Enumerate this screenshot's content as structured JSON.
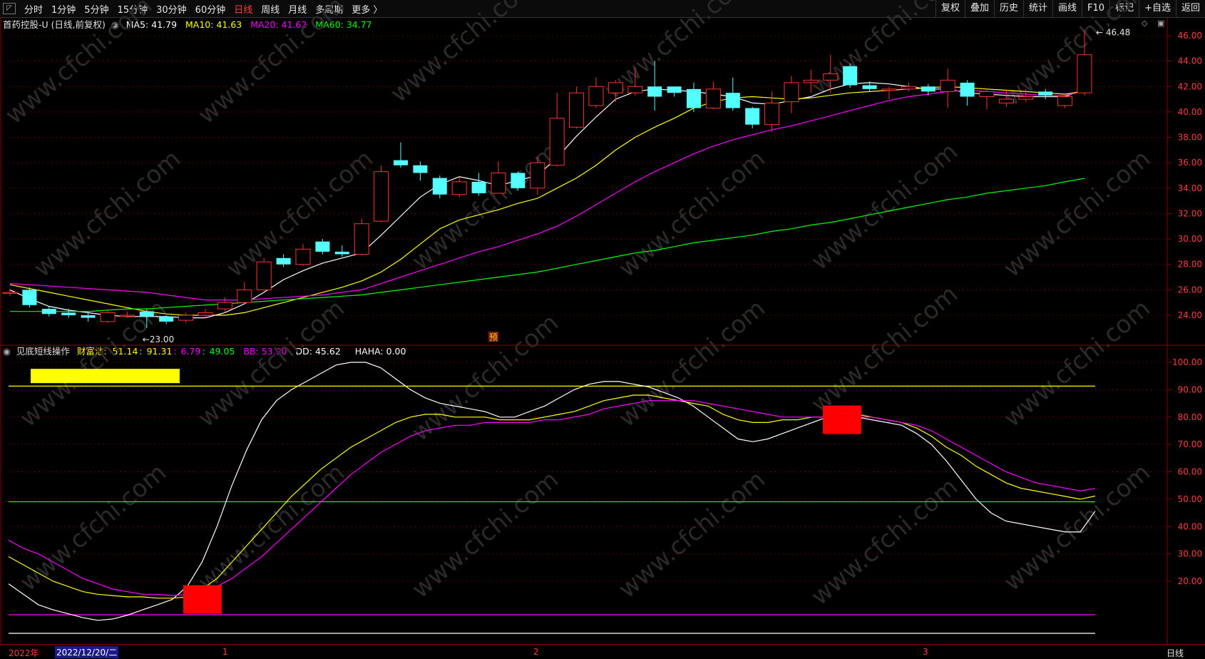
{
  "toolbar": {
    "timeframes": [
      "分时",
      "1分钟",
      "5分钟",
      "15分钟",
      "30分钟",
      "60分钟",
      "日线",
      "周线",
      "月线",
      "多周期",
      "更多 〉"
    ],
    "active_timeframe": "日线",
    "tools": [
      "复权",
      "叠加",
      "历史",
      "统计",
      "画线",
      "F10",
      "标记",
      "+自选",
      "返回"
    ]
  },
  "main_legend": {
    "title": "首药控股-U (日线,前复权)",
    "ma5": "MA5: 41.79",
    "ma10": "MA10: 41.63",
    "ma20": "MA20: 41.62",
    "ma60": "MA60: 34.77",
    "colors": {
      "ma5": "#ffffff",
      "ma10": "#ffff00",
      "ma20": "#ff00ff",
      "ma60": "#00ff00"
    }
  },
  "ind_legend": {
    "title": "见底短线操作",
    "label": "财富池:",
    "v1": "51.14",
    "v2": "91.31",
    "v3": "6.79",
    "v4": "49.05",
    "bb": "BB: 53.90",
    "dd": "DD: 45.62",
    "haha": "HAHA: 0.00"
  },
  "price_annotations": {
    "high": "46.48",
    "low": "23.00",
    "marker": "预"
  },
  "bottom": {
    "year": "2022年",
    "date_box": "2022/12/20/二",
    "months": [
      "1",
      "2",
      "3"
    ],
    "period": "日线"
  },
  "watermark": "www.cfchi.com",
  "chart_data": [
    {
      "type": "candlestick",
      "ylim": [
        22.0,
        47.0
      ],
      "y_ticks": [
        "46.00",
        "44.00",
        "42.00",
        "40.00",
        "38.00",
        "36.00",
        "34.00",
        "32.00",
        "30.00",
        "28.00",
        "26.00",
        "24.00"
      ],
      "candles": [
        [
          25.8,
          25.8,
          26.1,
          25.5
        ],
        [
          26.0,
          24.8,
          26.2,
          24.6
        ],
        [
          24.5,
          24.1,
          24.7,
          23.9
        ],
        [
          24.2,
          24.0,
          24.5,
          23.8
        ],
        [
          24.0,
          23.8,
          24.3,
          23.5
        ],
        [
          23.5,
          24.2,
          24.4,
          23.4
        ],
        [
          24.0,
          24.0,
          24.3,
          23.8
        ],
        [
          24.3,
          23.9,
          24.5,
          23.0
        ],
        [
          23.9,
          23.5,
          24.0,
          23.3
        ],
        [
          23.6,
          24.0,
          24.2,
          23.4
        ],
        [
          24.0,
          24.2,
          24.5,
          23.8
        ],
        [
          24.5,
          25.0,
          25.4,
          24.2
        ],
        [
          25.0,
          26.0,
          26.6,
          24.9
        ],
        [
          26.0,
          28.2,
          28.5,
          25.9
        ],
        [
          28.5,
          28.0,
          28.8,
          27.8
        ],
        [
          28.0,
          29.2,
          29.6,
          27.9
        ],
        [
          29.8,
          29.0,
          30.0,
          28.8
        ],
        [
          29.0,
          28.8,
          29.5,
          28.6
        ],
        [
          28.8,
          31.2,
          31.6,
          28.7
        ],
        [
          31.4,
          35.3,
          35.8,
          31.3
        ],
        [
          36.2,
          35.8,
          37.6,
          35.6
        ],
        [
          35.8,
          35.2,
          36.1,
          34.6
        ],
        [
          34.8,
          33.5,
          35.0,
          33.2
        ],
        [
          33.5,
          34.5,
          34.9,
          33.3
        ],
        [
          34.5,
          33.6,
          35.2,
          33.4
        ],
        [
          33.6,
          35.2,
          36.1,
          33.6
        ],
        [
          35.2,
          34.0,
          35.3,
          33.8
        ],
        [
          34.0,
          36.0,
          36.5,
          33.5
        ],
        [
          35.8,
          39.5,
          41.5,
          35.7
        ],
        [
          38.8,
          41.5,
          42.0,
          38.7
        ],
        [
          40.5,
          42.0,
          42.7,
          40.3
        ],
        [
          41.5,
          42.3,
          42.5,
          40.8
        ],
        [
          41.5,
          42.0,
          43.5,
          41.3
        ],
        [
          42.0,
          41.2,
          44.0,
          40.1
        ],
        [
          42.0,
          41.5,
          41.8,
          41.2
        ],
        [
          41.8,
          40.3,
          42.3,
          40.0
        ],
        [
          40.3,
          41.8,
          42.4,
          40.2
        ],
        [
          41.5,
          40.3,
          42.7,
          40.1
        ],
        [
          40.3,
          39.0,
          40.4,
          38.7
        ],
        [
          39.0,
          40.7,
          41.6,
          38.4
        ],
        [
          40.8,
          42.3,
          42.8,
          39.9
        ],
        [
          42.3,
          42.5,
          43.3,
          41.5
        ],
        [
          42.5,
          43.0,
          44.5,
          41.5
        ],
        [
          43.6,
          42.1,
          43.8,
          41.9
        ],
        [
          42.1,
          41.8,
          42.4,
          41.6
        ],
        [
          41.7,
          41.8,
          42.0,
          41.0
        ],
        [
          41.8,
          42.0,
          42.3,
          41.6
        ],
        [
          42.0,
          41.6,
          42.2,
          41.3
        ],
        [
          41.6,
          42.5,
          43.4,
          40.3
        ],
        [
          42.3,
          41.2,
          42.5,
          40.5
        ],
        [
          41.2,
          41.6,
          41.8,
          40.2
        ],
        [
          40.7,
          41.0,
          41.8,
          40.4
        ],
        [
          41.0,
          41.2,
          41.8,
          40.8
        ],
        [
          41.6,
          41.3,
          41.8,
          41.0
        ],
        [
          40.5,
          41.2,
          41.3,
          40.3
        ],
        [
          41.5,
          44.5,
          46.48,
          41.3
        ]
      ],
      "series": [
        {
          "name": "MA5",
          "values": [
            26.0,
            25.3,
            24.7,
            24.4,
            24.2,
            24.0,
            23.9,
            23.9,
            23.9,
            23.8,
            23.8,
            24.2,
            24.9,
            25.8,
            26.8,
            27.5,
            28.1,
            28.5,
            28.9,
            30.3,
            31.8,
            33.3,
            34.3,
            34.9,
            34.6,
            34.2,
            34.6,
            35.0,
            36.4,
            38.1,
            39.6,
            41.0,
            41.6,
            41.8,
            41.7,
            41.6,
            41.4,
            41.2,
            40.7,
            40.6,
            40.9,
            41.2,
            41.8,
            42.2,
            42.3,
            42.2,
            42.0,
            41.8,
            41.8,
            41.5,
            41.4,
            41.3,
            41.2,
            41.2,
            41.2,
            41.79
          ]
        },
        {
          "name": "MA10",
          "values": [
            26.4,
            26.1,
            25.8,
            25.5,
            25.2,
            24.9,
            24.6,
            24.3,
            24.1,
            24.0,
            24.0,
            24.0,
            24.2,
            24.6,
            25.0,
            25.4,
            25.8,
            26.2,
            26.7,
            27.4,
            28.4,
            29.6,
            30.8,
            31.5,
            31.9,
            32.3,
            32.8,
            33.2,
            34.0,
            34.8,
            35.8,
            37.0,
            38.0,
            38.8,
            39.5,
            40.3,
            40.8,
            41.1,
            41.2,
            41.1,
            41.0,
            41.1,
            41.3,
            41.5,
            41.6,
            41.7,
            41.8,
            41.9,
            42.0,
            41.9,
            41.8,
            41.7,
            41.6,
            41.5,
            41.4,
            41.63
          ]
        },
        {
          "name": "MA20",
          "values": [
            26.5,
            26.4,
            26.3,
            26.2,
            26.1,
            26.0,
            25.9,
            25.8,
            25.6,
            25.4,
            25.2,
            25.2,
            25.2,
            25.3,
            25.4,
            25.5,
            25.6,
            25.8,
            26.0,
            26.5,
            27.0,
            27.5,
            28.0,
            28.5,
            29.0,
            29.4,
            29.9,
            30.4,
            31.0,
            31.8,
            32.7,
            33.6,
            34.5,
            35.3,
            36.0,
            36.7,
            37.3,
            37.8,
            38.2,
            38.6,
            38.9,
            39.3,
            39.7,
            40.1,
            40.5,
            40.9,
            41.2,
            41.4,
            41.6,
            41.7,
            41.6,
            41.5,
            41.4,
            41.3,
            41.3,
            41.62
          ]
        },
        {
          "name": "MA60",
          "values": [
            24.3,
            24.3,
            24.3,
            24.3,
            24.3,
            24.4,
            24.5,
            24.5,
            24.6,
            24.7,
            24.8,
            24.9,
            25.0,
            25.1,
            25.2,
            25.3,
            25.4,
            25.5,
            25.6,
            25.8,
            26.0,
            26.2,
            26.4,
            26.6,
            26.8,
            27.0,
            27.2,
            27.4,
            27.7,
            28.0,
            28.3,
            28.6,
            28.9,
            29.1,
            29.4,
            29.7,
            29.9,
            30.1,
            30.3,
            30.6,
            30.8,
            31.1,
            31.3,
            31.6,
            31.9,
            32.2,
            32.5,
            32.8,
            33.1,
            33.3,
            33.6,
            33.8,
            34.0,
            34.2,
            34.5,
            34.77
          ]
        }
      ]
    },
    {
      "type": "line",
      "ylim": [
        0,
        105
      ],
      "y_ticks": [
        "100.00",
        "90.00",
        "80.00",
        "70.00",
        "60.00",
        "50.00",
        "40.00",
        "30.00",
        "20.00"
      ],
      "hlines": [
        91.31,
        49.05,
        6.79,
        0
      ],
      "signals": [
        {
          "index": 10,
          "value": 13
        },
        {
          "index": 43,
          "value": 79
        }
      ],
      "yellow_bar_value": 95,
      "series": [
        {
          "name": "",
          "values": [
            19,
            15,
            11,
            9,
            7.5,
            6,
            5,
            5.5,
            7,
            9,
            11,
            13,
            18,
            27,
            40,
            55,
            68,
            79,
            86,
            90,
            93,
            96,
            99,
            100,
            100,
            98,
            94,
            90,
            87,
            85,
            84,
            83,
            82,
            80,
            80,
            82,
            84,
            87,
            90,
            92,
            93,
            93,
            92,
            91,
            89,
            87,
            84,
            80,
            76,
            72,
            71,
            72,
            74,
            76,
            78,
            80,
            81,
            80,
            79,
            78,
            77,
            74,
            70,
            64,
            57,
            50,
            45,
            42,
            41,
            40,
            39,
            38,
            38,
            45.62
          ]
        },
        {
          "name": "",
          "values": [
            29,
            26,
            23,
            20,
            18,
            16,
            15,
            14.5,
            14,
            14,
            13.5,
            13.5,
            14,
            17,
            21,
            27,
            33,
            39,
            45,
            51,
            56,
            61,
            65,
            69,
            72,
            75,
            78,
            80,
            81,
            81,
            80,
            80,
            80,
            79,
            79,
            79,
            80,
            81,
            82,
            84,
            86,
            87,
            88,
            88,
            87,
            86,
            85,
            84,
            81,
            79,
            78,
            78,
            79,
            79,
            80,
            80,
            81,
            81,
            80,
            79,
            78,
            76,
            73,
            69,
            66,
            62,
            59,
            56,
            54,
            53,
            52,
            51,
            50,
            51.14
          ]
        },
        {
          "name": "",
          "values": [
            35,
            32,
            30,
            27,
            24,
            21,
            19,
            17,
            16,
            15,
            15,
            14.5,
            15,
            16,
            18,
            21,
            25,
            29,
            34,
            39,
            44,
            49,
            54,
            59,
            63,
            67,
            70,
            73,
            75,
            76,
            77,
            77,
            78,
            78,
            78,
            78,
            79,
            79,
            80,
            81,
            83,
            84,
            85,
            86,
            86,
            86,
            86,
            85,
            84,
            83,
            82,
            81,
            80,
            80,
            80,
            80,
            80,
            80,
            80,
            79,
            78,
            77,
            75,
            72,
            69,
            66,
            63,
            60,
            58,
            56,
            55,
            54,
            53,
            53.9
          ]
        }
      ]
    }
  ]
}
